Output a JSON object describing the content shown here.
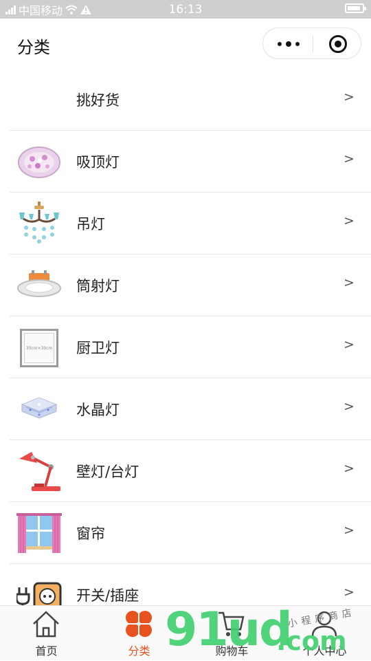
{
  "status_bar": {
    "carrier": "中国移动",
    "time": "16:13",
    "battery_level": 0.9
  },
  "header": {
    "title": "分类"
  },
  "categories": [
    {
      "label": "挑好货",
      "arrow": ">",
      "icon": "none"
    },
    {
      "label": "吸顶灯",
      "arrow": ">",
      "icon": "ceiling-light-icon"
    },
    {
      "label": "吊灯",
      "arrow": ">",
      "icon": "chandelier-icon"
    },
    {
      "label": "筒射灯",
      "arrow": ">",
      "icon": "downlight-icon"
    },
    {
      "label": "厨卫灯",
      "arrow": ">",
      "icon": "kitchen-bath-light-icon",
      "thumb_text": "30cm×30cm"
    },
    {
      "label": "水晶灯",
      "arrow": ">",
      "icon": "crystal-light-icon"
    },
    {
      "label": "壁灯/台灯",
      "arrow": ">",
      "icon": "desk-lamp-icon"
    },
    {
      "label": "窗帘",
      "arrow": ">",
      "icon": "curtain-icon"
    },
    {
      "label": "开关/插座",
      "arrow": ">",
      "icon": "switch-socket-icon"
    }
  ],
  "tabbar": {
    "tabs": [
      {
        "label": "首页",
        "icon": "home-icon",
        "active": false
      },
      {
        "label": "分类",
        "icon": "clover-icon",
        "active": true
      },
      {
        "label": "购物车",
        "icon": "cart-icon",
        "active": false
      },
      {
        "label": "个人中心",
        "icon": "user-icon",
        "active": false
      }
    ]
  },
  "watermark": {
    "big": "91ud",
    "suffix": ".com",
    "small": "小程序商店"
  },
  "colors": {
    "accent": "#e8521e",
    "watermark_green": "#3fcf6f",
    "statusbar_bg": "#cfcfcf",
    "separator": "#e6e6e6"
  }
}
